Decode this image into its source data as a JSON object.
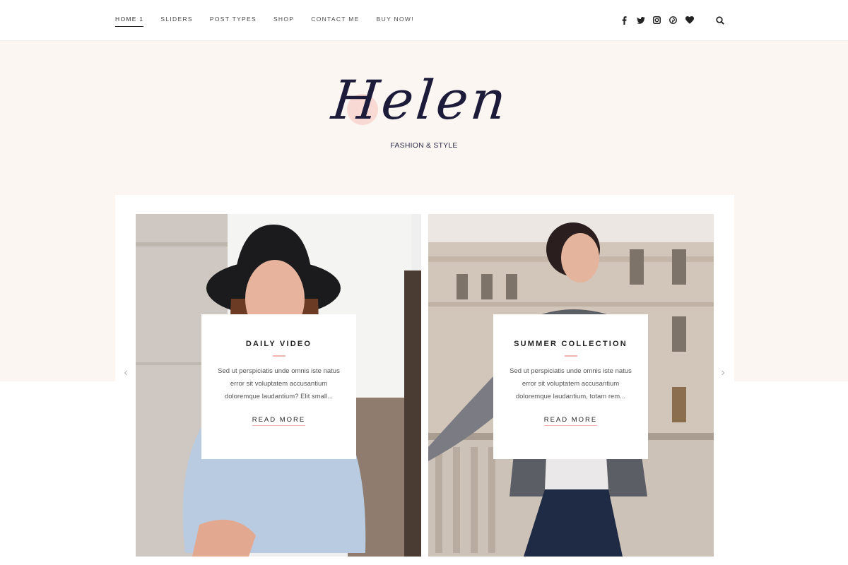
{
  "nav": {
    "items": [
      {
        "label": "HOME 1",
        "active": true
      },
      {
        "label": "SLIDERS",
        "active": false
      },
      {
        "label": "POST TYPES",
        "active": false
      },
      {
        "label": "SHOP",
        "active": false
      },
      {
        "label": "CONTACT ME",
        "active": false
      },
      {
        "label": "BUY NOW!",
        "active": false
      }
    ],
    "social_icons": [
      "facebook-icon",
      "twitter-icon",
      "instagram-icon",
      "pinterest-icon",
      "heart-icon"
    ],
    "search_icon": "search-icon"
  },
  "brand": {
    "logo": "Helen",
    "tagline": "FASHION & STYLE",
    "accent_color": "#f2b6b0",
    "ink_color": "#1d1b3a",
    "hero_bg": "#fbf6f2"
  },
  "slider": {
    "prev_icon": "chevron-left-icon",
    "next_icon": "chevron-right-icon",
    "slides": [
      {
        "title": "DAILY VIDEO",
        "excerpt": "Sed ut perspiciatis unde omnis iste natus error sit voluptatem accusantium doloremque laudantium? Elit small...",
        "read_more": "READ MORE",
        "image": "woman in black hat and denim shirt"
      },
      {
        "title": "SUMMER COLLECTION",
        "excerpt": "Sed ut perspiciatis unde omnis iste natus error sit voluptatem accusantium doloremque laudantium, totam rem...",
        "read_more": "READ MORE",
        "image": "woman in patterned cardigan on city stairs"
      }
    ]
  }
}
